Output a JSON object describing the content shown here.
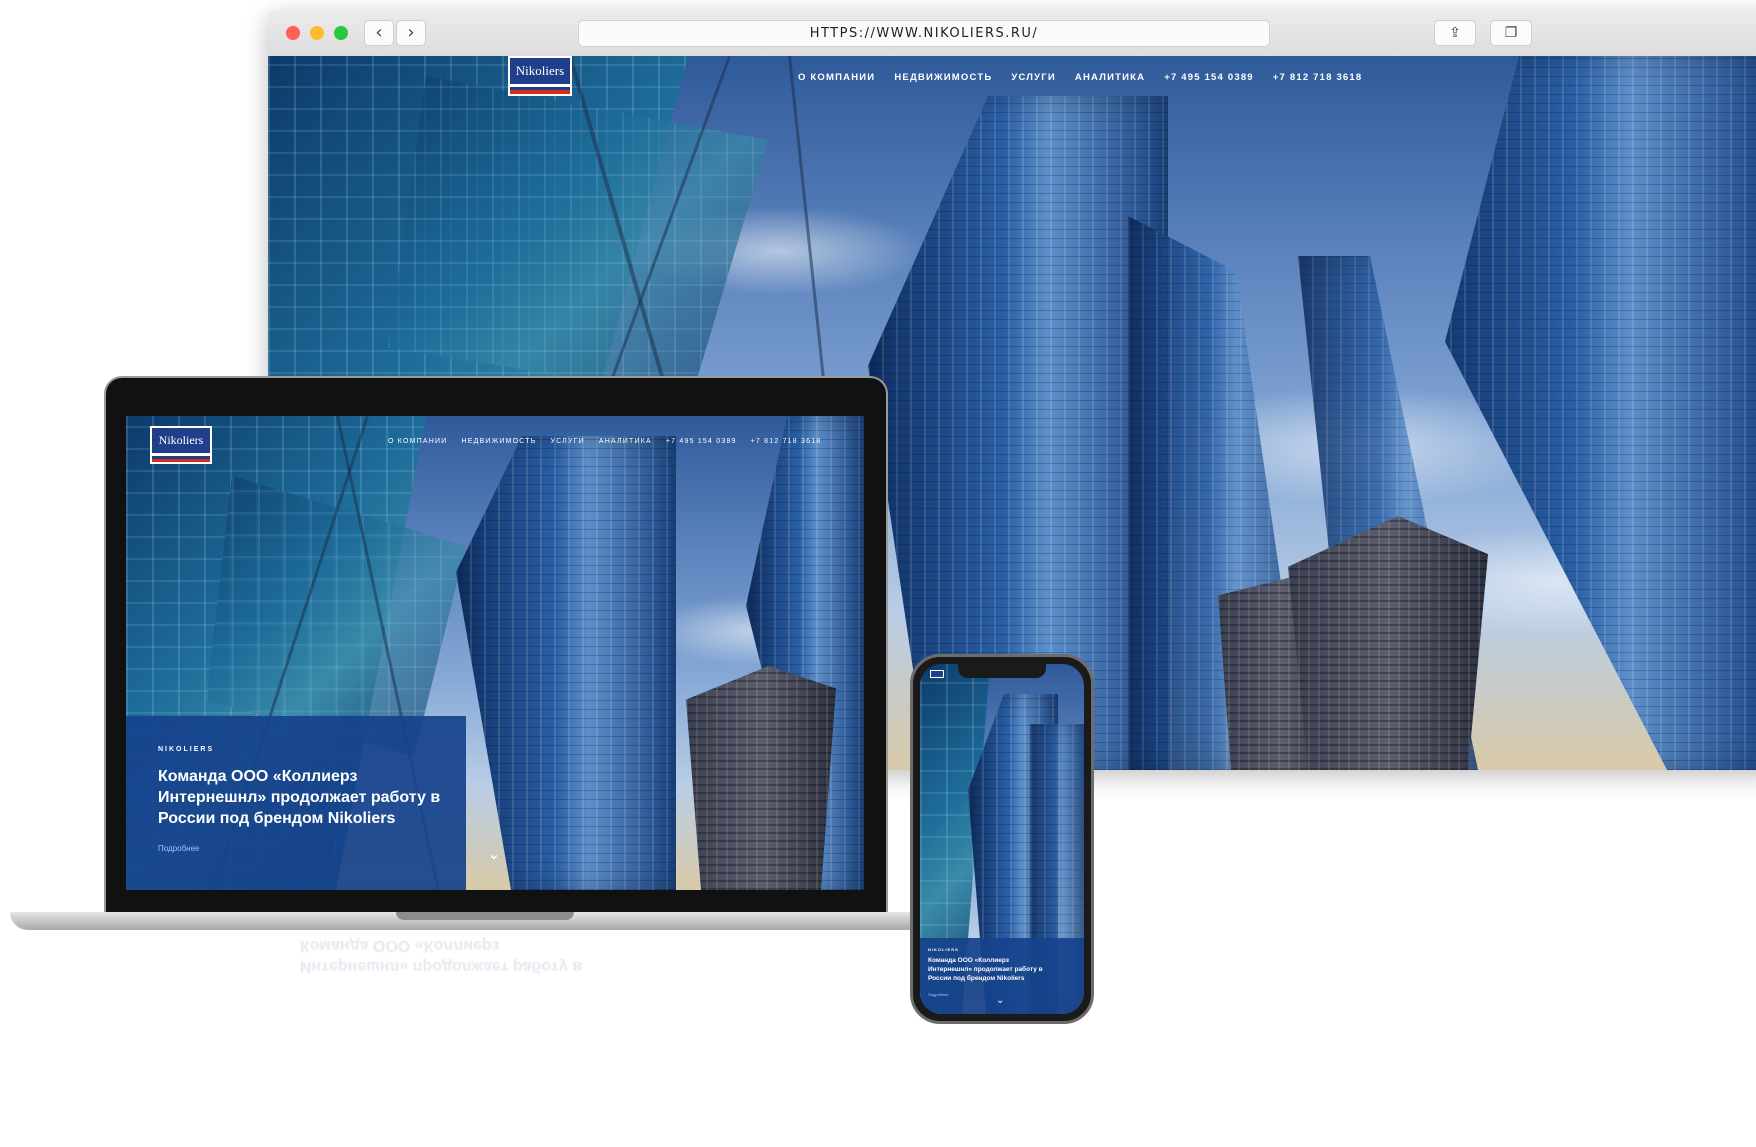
{
  "browser": {
    "url": "HTTPS://WWW.NIKOLIERS.RU/",
    "back_icon": "chevron-left-icon",
    "forward_icon": "chevron-right-icon",
    "share_icon": "share-icon",
    "tabs_icon": "tabs-icon",
    "traffic_lights": [
      "#ff5f57",
      "#febc2e",
      "#28c840"
    ]
  },
  "site": {
    "logo": "Nikoliers",
    "nav": [
      "О КОМПАНИИ",
      "НЕДВИЖИМОСТЬ",
      "УСЛУГИ",
      "АНАЛИТИКА",
      "+7 495 154 0389",
      "+7 812 718 3618"
    ]
  },
  "hero": {
    "eyebrow": "NIKOLIERS",
    "headline_line1": "Команда ООО «Коллиерз",
    "headline_line2": "Интернешнл» продолжает работу в",
    "headline_line3": "России под брендом Nikoliers",
    "more_link": "Подробнее",
    "scroll_icon": "chevron-down-icon"
  },
  "mobile": {
    "eyebrow": "NIKOLIERS",
    "headline_line1": "Команда ООО «Коллиерз",
    "headline_line2": "Интернешнл» продолжает работу в",
    "headline_line3": "России под брендом Nikoliers",
    "more_link": "Подробнее"
  },
  "brand_colors": {
    "navy": "#1f3f8a",
    "card_blue": "#16428c",
    "stripe_red": "#d52b1e"
  }
}
